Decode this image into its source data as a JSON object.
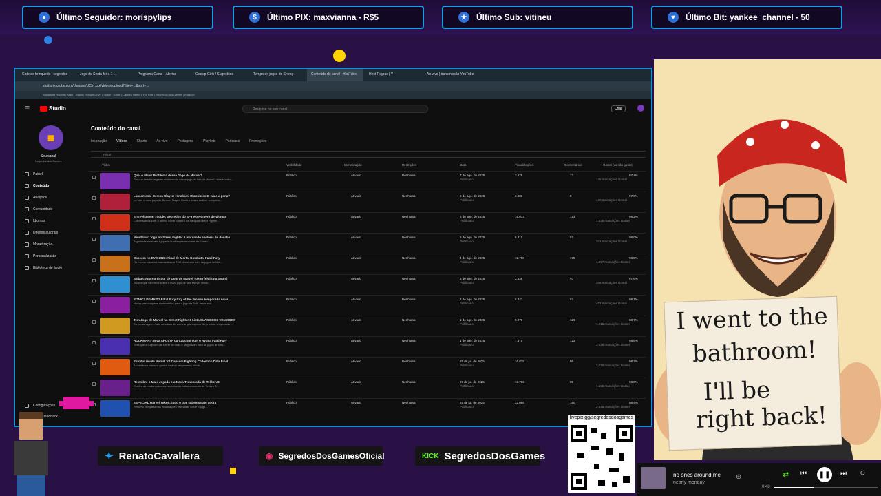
{
  "alerts": [
    {
      "icon": "person-icon",
      "text": "Último Seguidor: morispylips"
    },
    {
      "icon": "dollar-icon",
      "text": "Último PIX: maxvianna - R$5"
    },
    {
      "icon": "star-icon",
      "text": "Último Sub: vitineu"
    },
    {
      "icon": "heart-icon",
      "text": "Último Bit: yankee_channel - 50"
    }
  ],
  "browser": {
    "tabs": [
      "Gato de brinquedo | segredos",
      "Jogo de Sexta-feira 1 ...",
      "Programa Canal - Alertas",
      "Gossip Girls / Sugestões",
      "Tempo de jogos do Sheng",
      "Conteúdo do canal - YouTube",
      "Host Regras | Y",
      "Ao vivo | transmissão YouTube"
    ],
    "active_tab": "Conteúdo do canal - YouTube",
    "url": "studio.youtube.com/channel/UCe_xxx/videos/upload?filter=...&sort=...",
    "bookmarks": "Instalação Rápida  |  Apps  |  Jogos  |  Google Drive  |  Twitch  |  Gmail  |  Canva  |  Netflix  |  YouTube  |  Segredos dos Games  |  Amazon"
  },
  "studio": {
    "logo": "Studio",
    "search_placeholder": "Pesquise no seu canal",
    "create_label": "Criar",
    "channel_name": "Seu canal",
    "channel_sub": "Segredos dos Games",
    "nav": [
      "Painel",
      "Conteúdo",
      "Analytics",
      "Comunidade",
      "Idiomas",
      "Direitos autorais",
      "Monetização",
      "Personalização",
      "Biblioteca de áudio"
    ],
    "settings_label": "Configurações",
    "feedback_label": "Enviar feedback",
    "page_title": "Conteúdo do canal",
    "content_tabs": [
      "Inspiração",
      "Vídeos",
      "Shorts",
      "Ao vivo",
      "Postagens",
      "Playlists",
      "Podcasts",
      "Promoções"
    ],
    "filter_label": "Filtrar",
    "columns": [
      "Vídeo",
      "Visibilidade",
      "Monetização",
      "Restrições",
      "Data",
      "Visualizações",
      "Comentários",
      "Gostei (vs não gostei)"
    ],
    "rows": [
      {
        "title": "Qual o Maior Problema desse Jogo da Marvel?",
        "desc": "Por que tem tanta gente reclamando desse jogo de luta da Marvel? Neste vídeo...",
        "visibility": "Público",
        "monet": "Ativado",
        "restr": "Nenhuma",
        "date": "7 de ago. de 2025",
        "status": "Publicado",
        "views": "3.476",
        "comments": "13",
        "likes": "97,4%",
        "likes_sub": "145 marcações Gostei",
        "thumb": "#7a2fb0"
      },
      {
        "title": "Lançamento Demon Slayer: Hinokami Chronicles 2 - vale a pena?",
        "desc": "Lá vem o novo jogo de Demon Slayer. Confira nossa análise completa...",
        "visibility": "Público",
        "monet": "Ativado",
        "restr": "Nenhuma",
        "date": "6 de ago. de 2025",
        "status": "Publicado",
        "views": "3.083",
        "comments": "9",
        "likes": "97,0%",
        "likes_sub": "130 marcações Gostei",
        "thumb": "#b0203a"
      },
      {
        "title": "Entrevista em Tóquio: Segredos do SF6 e o Número de Vítimas",
        "desc": "Conversamos com o diretor sobre o futuro da franquia Street Fighter...",
        "visibility": "Público",
        "monet": "Ativado",
        "restr": "Nenhuma",
        "date": "6 de ago. de 2025",
        "status": "Publicado",
        "views": "16.073",
        "comments": "153",
        "likes": "98,2%",
        "likes_sub": "1.035 marcações Gostei",
        "thumb": "#d0301a"
      },
      {
        "title": "Mindblow: Jogo no Street Fighter 6 marcando a vitória do desafio",
        "desc": "Jogadores mostram a jogada mais impressionante do torneio...",
        "visibility": "Público",
        "monet": "Ativado",
        "restr": "Nenhuma",
        "date": "5 de ago. de 2025",
        "status": "Publicado",
        "views": "6.310",
        "comments": "57",
        "likes": "98,0%",
        "likes_sub": "341 marcações Gostei",
        "thumb": "#3f6fb0"
      },
      {
        "title": "Capcom no EVO 2025: Final de Mortal Kombat x Fatal Fury",
        "desc": "Os momentos mais marcantes da EVO deste ano com os jogos de luta...",
        "visibility": "Público",
        "monet": "Ativado",
        "restr": "Nenhuma",
        "date": "4 de ago. de 2025",
        "status": "Publicado",
        "views": "12.750",
        "comments": "175",
        "likes": "98,5%",
        "likes_sub": "1.257 marcações Gostei",
        "thumb": "#c8701a"
      },
      {
        "title": "Saiba como Partir por de Dom de Marvel Tokon (Fighting Souls)",
        "desc": "Tudo o que sabemos sobre o novo jogo de luta Marvel Tokon...",
        "visibility": "Público",
        "monet": "Ativado",
        "restr": "Nenhuma",
        "date": "3 de ago. de 2025",
        "status": "Publicado",
        "views": "2.836",
        "comments": "40",
        "likes": "97,6%",
        "likes_sub": "286 marcações Gostei",
        "thumb": "#2f8fd0"
      },
      {
        "title": "SONIC? DEMAIS? Fatal Fury City of the Wolves temporada nova",
        "desc": "Novos personagens confirmados para o jogo da SNK neste ano...",
        "visibility": "Público",
        "monet": "Ativado",
        "restr": "Nenhuma",
        "date": "2 de ago. de 2025",
        "status": "Publicado",
        "views": "5.247",
        "comments": "52",
        "likes": "98,1%",
        "likes_sub": "452 marcações Gostei",
        "thumb": "#8a1fa0"
      },
      {
        "title": "Tem Jogo de Marvel no Street Fighter 6 Lista CLASSICOS VENDIDOS",
        "desc": "Os personagens mais vendidos do ano e o que esperar da próxima temporada...",
        "visibility": "Público",
        "monet": "Ativado",
        "restr": "Nenhuma",
        "date": "1 de ago. de 2025",
        "status": "Publicado",
        "views": "9.278",
        "comments": "123",
        "likes": "98,7%",
        "likes_sub": "1.215 marcações Gostei",
        "thumb": "#d09a20"
      },
      {
        "title": "ROCKMAN? Nova APOSTA da Capcom com o Ryuna Fatal Fury",
        "desc": "Será que a Capcom vai trazer de volta o Mega Man para os jogos de luta...",
        "visibility": "Público",
        "monet": "Ativado",
        "restr": "Nenhuma",
        "date": "1 de ago. de 2025",
        "status": "Publicado",
        "views": "7.375",
        "comments": "122",
        "likes": "98,6%",
        "likes_sub": "1.038 marcações Gostei",
        "thumb": "#4a2fb0"
      },
      {
        "title": "Estúdio revela Marvel VS Capcom Fighting Collection Data Final",
        "desc": "A coletânea clássica ganha data de lançamento oficial...",
        "visibility": "Público",
        "monet": "Ativado",
        "restr": "Nenhuma",
        "date": "29 de jul. de 2025",
        "status": "Publicado",
        "views": "16.838",
        "comments": "86",
        "likes": "98,2%",
        "likes_sub": "2.070 marcações Gostei",
        "thumb": "#e05a10"
      },
      {
        "title": "Relembre o Mais Jogado e a Nova Temporada de Tekken 8",
        "desc": "Confira as mudanças mais recentes do balanceamento de Tekken 8...",
        "visibility": "Público",
        "monet": "Ativado",
        "restr": "Nenhuma",
        "date": "27 de jul. de 2025",
        "status": "Publicado",
        "views": "13.786",
        "comments": "89",
        "likes": "98,0%",
        "likes_sub": "1.136 marcações Gostei",
        "thumb": "#6a208a"
      },
      {
        "title": "ESPECIAL Marvel Tokon: tudo o que sabemos até agora",
        "desc": "Resumo completo das informações reveladas sobre o jogo...",
        "visibility": "Público",
        "monet": "Ativado",
        "restr": "Nenhuma",
        "date": "25 de jul. de 2025",
        "status": "Publicado",
        "views": "22.066",
        "comments": "160",
        "likes": "98,4%",
        "likes_sub": "2.445 marcações Gostei",
        "thumb": "#2050b0"
      }
    ]
  },
  "sign": {
    "line1": "I went to the",
    "line2": "bathroom!",
    "line3": "I'll be",
    "line4": "right back!"
  },
  "socials": [
    {
      "icon": "twitter-icon",
      "text": "RenatoCavallera"
    },
    {
      "icon": "instagram-icon",
      "text": "SegredosDosGamesOficial"
    },
    {
      "icon": "kick-icon",
      "badge": "KICK",
      "text": "SegredosDosGames"
    }
  ],
  "qr": {
    "link": "livepix.gg/segredosdosgames"
  },
  "player": {
    "song": "no ones around me",
    "artist": "nearly monday",
    "time": "0:48"
  },
  "colors": {
    "accent": "#1c9be0",
    "background": "#2a1145",
    "alert_dot": "#ffd400"
  }
}
